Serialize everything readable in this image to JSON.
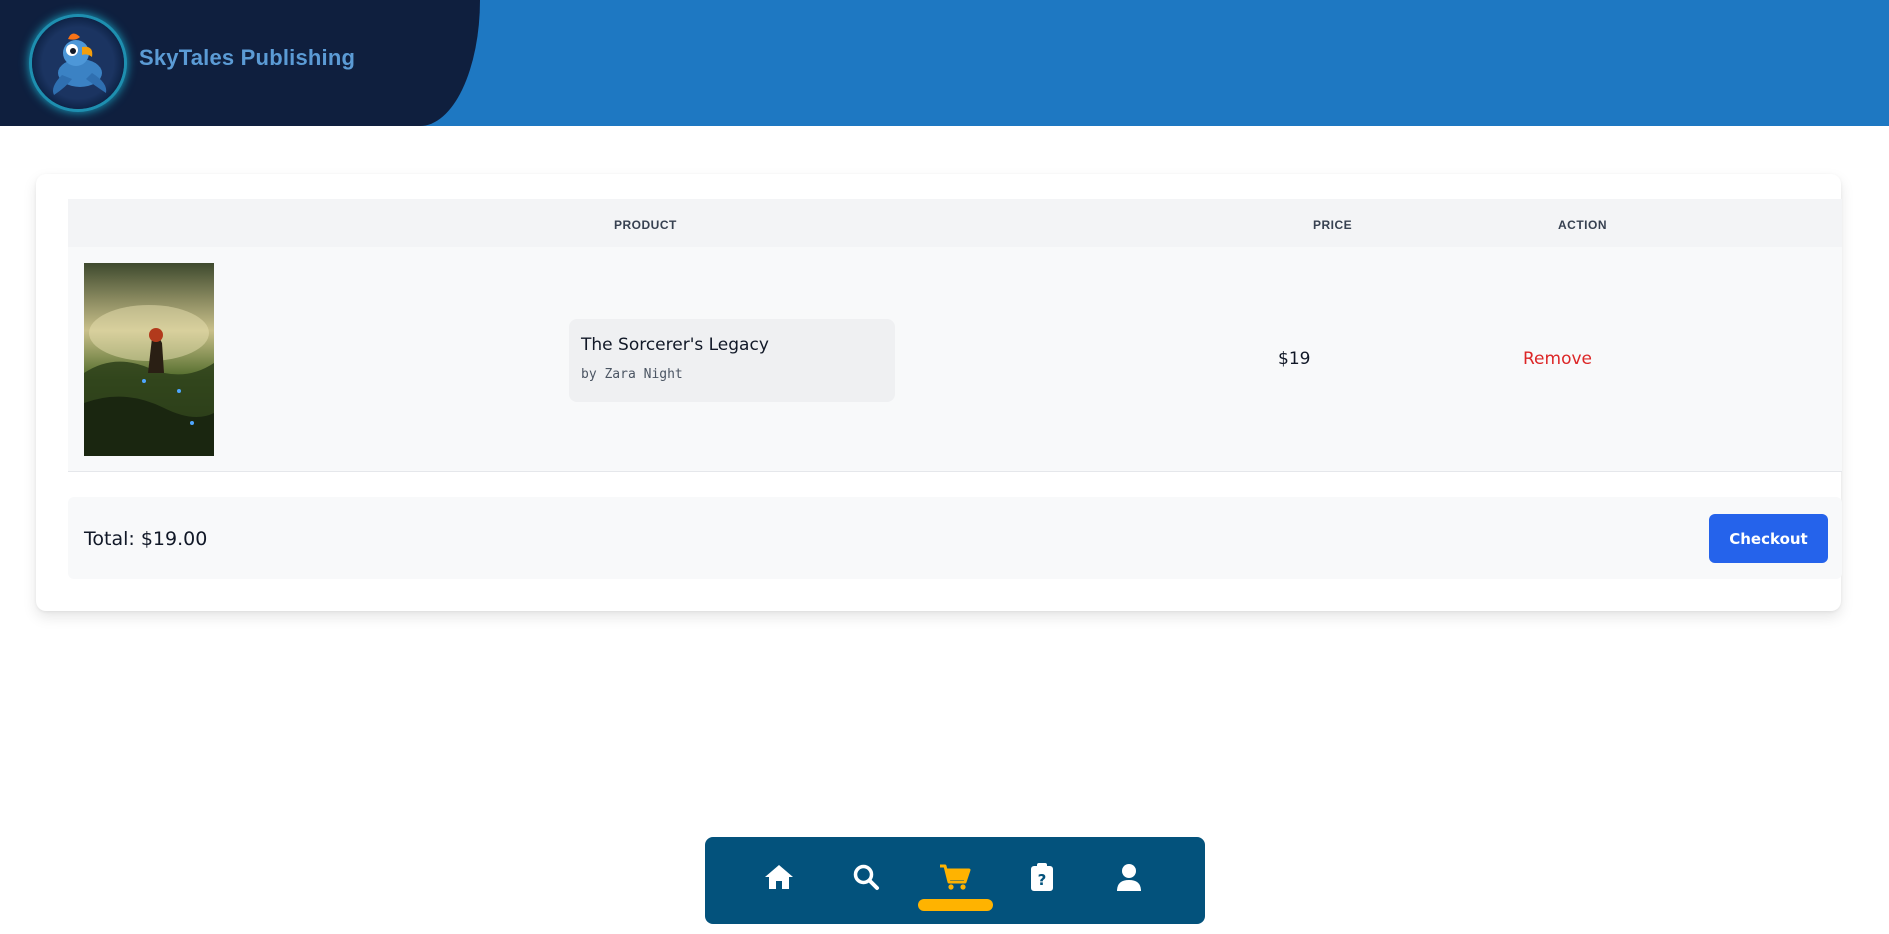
{
  "brand": {
    "name": "SkyTales Publishing",
    "logo_icon": "parrot-logo"
  },
  "cart": {
    "columns": {
      "product": "PRODUCT",
      "price": "PRICE",
      "action": "ACTION"
    },
    "items": [
      {
        "cover_icon": "book-cover-image",
        "title": "The Sorcerer's Legacy",
        "author": "by Zara Night",
        "price": "$19",
        "action": "Remove"
      }
    ],
    "total": "Total: $19.00",
    "checkout_label": "Checkout"
  },
  "nav": {
    "items": [
      {
        "name": "home",
        "icon": "home-icon",
        "active": false
      },
      {
        "name": "search",
        "icon": "search-icon",
        "active": false
      },
      {
        "name": "cart",
        "icon": "cart-icon",
        "active": true
      },
      {
        "name": "help",
        "icon": "help-clipboard-icon",
        "active": false
      },
      {
        "name": "profile",
        "icon": "user-icon",
        "active": false
      }
    ]
  },
  "colors": {
    "header_blue": "#1e78c2",
    "brand_navy": "#0f1f3e",
    "nav_bg": "#03527c",
    "active_accent": "#ffb300",
    "checkout_blue": "#2563eb",
    "remove_red": "#dc2626"
  }
}
